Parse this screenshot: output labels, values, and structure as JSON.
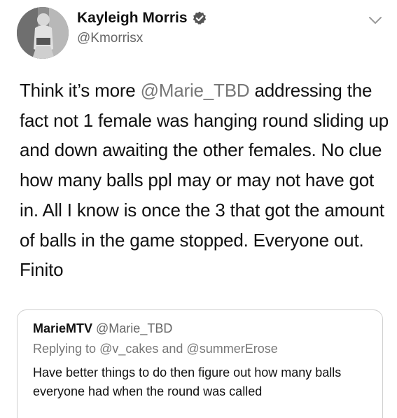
{
  "author": {
    "name": "Kayleigh Morris",
    "handle": "@Kmorrisx",
    "verified": true
  },
  "tweet": {
    "text_before": "Think it’s more ",
    "mention": "@Marie_TBD",
    "text_after": " addressing the fact not 1 female was hanging round sliding up and down awaiting the other females. No clue how many balls ppl may or may not have got in. All I know is once the 3 that got the amount of balls in the game stopped. Everyone out. Finito"
  },
  "quoted": {
    "name": "MarieMTV",
    "handle": "@Marie_TBD",
    "replying_prefix": "Replying to ",
    "replying_user1": "@v_cakes",
    "replying_and": " and ",
    "replying_user2": "@summerErose",
    "text": "Have better things to do then figure out how many balls everyone had when the round was called"
  },
  "icons": {
    "verified": "verified-badge-icon",
    "menu": "chevron-down-icon"
  },
  "colors": {
    "text": "#111111",
    "secondary": "#666666",
    "border": "#cfcfcf",
    "background": "#ffffff"
  }
}
